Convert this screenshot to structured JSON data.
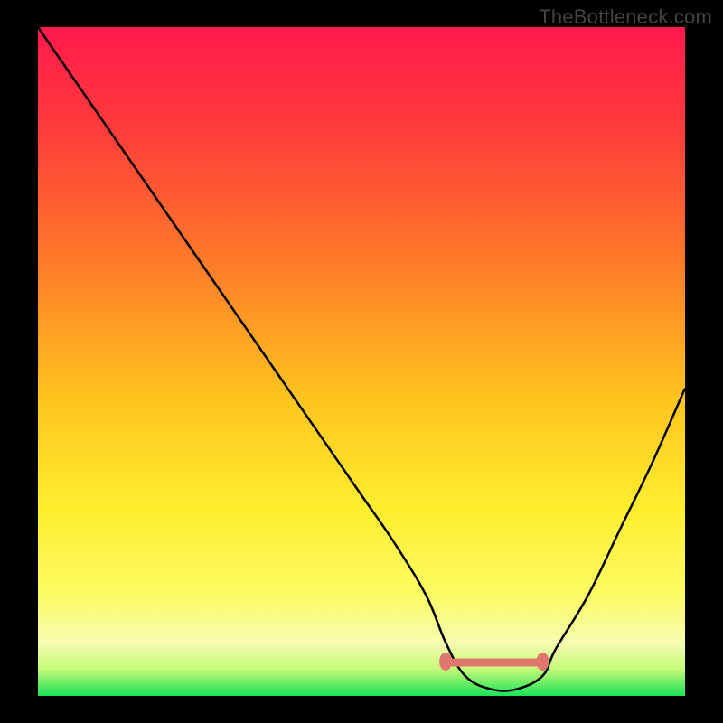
{
  "watermark": "TheBottleneck.com",
  "chart_data": {
    "type": "line",
    "title": "",
    "xlabel": "",
    "ylabel": "",
    "xlim": [
      0,
      100
    ],
    "ylim": [
      0,
      100
    ],
    "x": [
      0,
      5,
      10,
      15,
      20,
      25,
      30,
      35,
      40,
      45,
      50,
      55,
      60,
      63,
      66,
      70,
      74,
      78,
      80,
      85,
      90,
      95,
      100
    ],
    "values": [
      100,
      93,
      86,
      79,
      72,
      65,
      58,
      51,
      44,
      37,
      30,
      23,
      15,
      8,
      3,
      1,
      1,
      3,
      7,
      15,
      25,
      35,
      46
    ],
    "valley_marker": {
      "x_start": 63,
      "x_end": 78,
      "y": 5
    },
    "gradient_stops": [
      {
        "offset": 0.0,
        "color": "#ff1a4d"
      },
      {
        "offset": 0.15,
        "color": "#ff3b3b"
      },
      {
        "offset": 0.35,
        "color": "#ff7a29"
      },
      {
        "offset": 0.55,
        "color": "#ffc21f"
      },
      {
        "offset": 0.72,
        "color": "#ffee2e"
      },
      {
        "offset": 0.85,
        "color": "#fdfb65"
      },
      {
        "offset": 0.92,
        "color": "#f6fcb0"
      },
      {
        "offset": 0.96,
        "color": "#c6f97a"
      },
      {
        "offset": 1.0,
        "color": "#19e356"
      }
    ]
  }
}
